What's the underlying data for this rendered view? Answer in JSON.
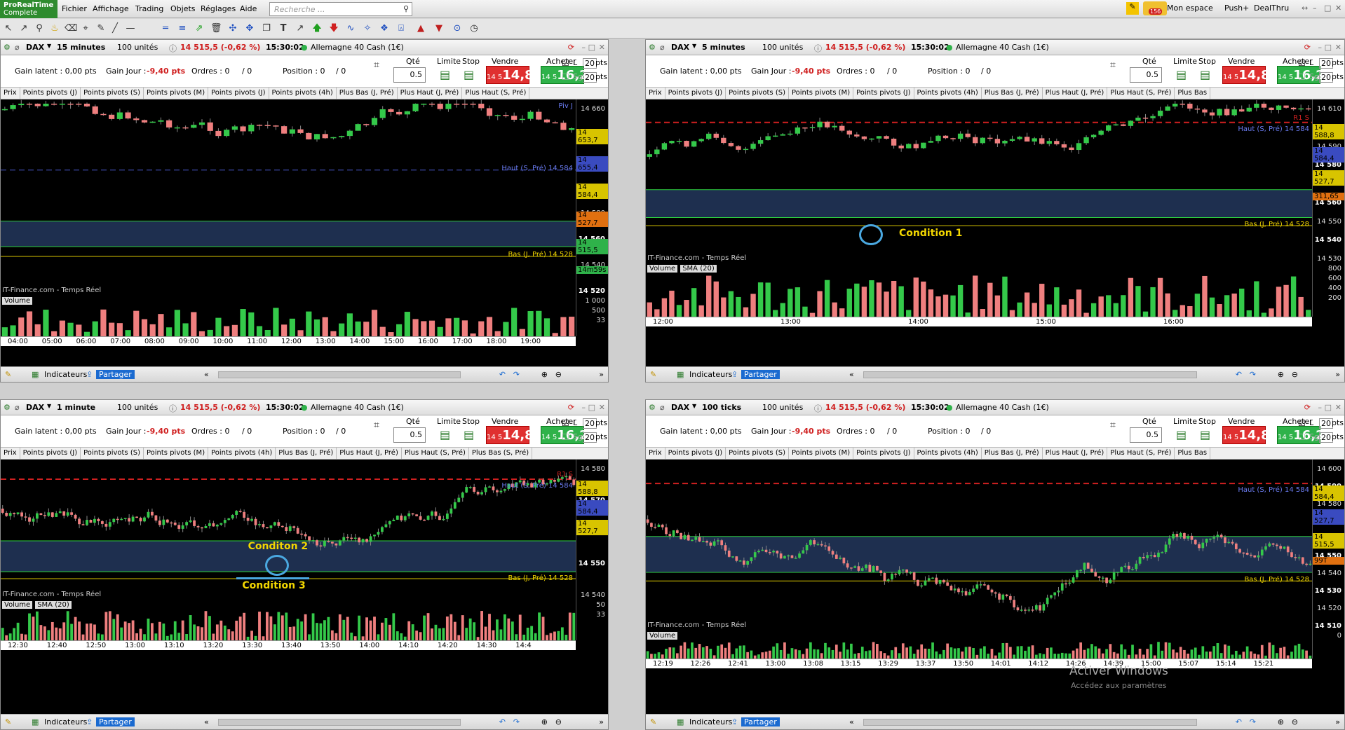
{
  "app": {
    "logo_line1": "ProRealTime",
    "logo_line2": "Complete"
  },
  "menu": [
    "Fichier",
    "Affichage",
    "Trading",
    "Objets",
    "Réglages",
    "Aide"
  ],
  "search": {
    "placeholder": "Recherche ..."
  },
  "topright": {
    "mon_espace": "Mon espace",
    "push": "Push+",
    "dealthru": "DealThru",
    "badge": "156"
  },
  "panels": [
    {
      "instrument": "DAX",
      "interval": "15 minutes",
      "units": "100 unités",
      "price_change": "14 515,5 (-0,62 %)",
      "time": "15:30:02",
      "market": "Allemagne 40 Cash (1€)",
      "gain_latent": "Gain latent : 0,00 pts",
      "gain_jour_label": "Gain Jour :",
      "gain_jour": "-9,40 pts",
      "ordres": "Ordres : 0",
      "ordres2": "/ 0",
      "position": "Position : 0",
      "position2": "/ 0",
      "qte_label": "Qté",
      "qte": "0.5",
      "limite": "Limite",
      "stop": "Stop",
      "vendre": "Vendre",
      "acheter": "Acheter",
      "sell_small": "14 5",
      "sell_big": "14,8",
      "buy_small": "14 5",
      "buy_big": "16,2",
      "l": "L",
      "sg": "Sg",
      "pts1": "20",
      "pts2": "20",
      "ptsl": "pts",
      "indicators": [
        "Prix",
        "Points pivots (J)",
        "Points pivots (S)",
        "Points pivots (M)",
        "Points pivots (J)",
        "Points pivots (4h)",
        "Plus Bas (J, Pré)",
        "Plus Haut (J, Pré)",
        "Plus Haut (S, Pré)"
      ],
      "yticks": [
        "14 660",
        "14 640",
        "14 620",
        "14 600",
        "14 580",
        "14 560",
        "14 540",
        "14 520"
      ],
      "price_tags": [
        "14 653,7",
        "14 655,4",
        "14 584,4",
        "14 527,7",
        "14 515,5",
        "14m59s"
      ],
      "labels": [
        "Piv J",
        "Haut (S, Pré) 14 584",
        "Bas (J, Pré) 14 528"
      ],
      "source": "IT-Finance.com - Temps Réel",
      "volume": "Volume",
      "vol_ticks": [
        "1 000",
        "500",
        "33"
      ],
      "xticks": [
        "04:00",
        "05:00",
        "06:00",
        "07:00",
        "08:00",
        "09:00",
        "10:00",
        "11:00",
        "12:00",
        "13:00",
        "14:00",
        "15:00",
        "16:00",
        "17:00",
        "18:00",
        "19:00"
      ],
      "footer": {
        "indicateurs": "Indicateurs",
        "partager": "Partager"
      }
    },
    {
      "instrument": "DAX",
      "interval": "5 minutes",
      "units": "100 unités",
      "price_change": "14 515,5 (-0,62 %)",
      "time": "15:30:02",
      "market": "Allemagne 40 Cash (1€)",
      "gain_latent": "Gain latent : 0,00 pts",
      "gain_jour_label": "Gain Jour :",
      "gain_jour": "-9,40 pts",
      "ordres": "Ordres : 0",
      "ordres2": "/ 0",
      "position": "Position : 0",
      "position2": "/ 0",
      "qte_label": "Qté",
      "qte": "0.5",
      "limite": "Limite",
      "stop": "Stop",
      "vendre": "Vendre",
      "acheter": "Acheter",
      "sell_small": "14 5",
      "sell_big": "14,8",
      "buy_small": "14 5",
      "buy_big": "16,2",
      "l": "L",
      "sg": "Sg",
      "pts1": "20",
      "pts2": "20",
      "ptsl": "pts",
      "indicators": [
        "Prix",
        "Points pivots (J)",
        "Points pivots (S)",
        "Points pivots (M)",
        "Points pivots (J)",
        "Points pivots (4h)",
        "Plus Bas (J, Pré)",
        "Plus Haut (J, Pré)",
        "Plus Haut (S, Pré)",
        "Plus Bas"
      ],
      "yticks": [
        "14 610",
        "14 600",
        "14 590",
        "14 580",
        "14 570",
        "14 560",
        "14 550",
        "14 540",
        "14 530"
      ],
      "price_tags": [
        "14 588,8",
        "14 584,4",
        "14 527,7",
        "311,65"
      ],
      "labels": [
        "R1 S",
        "Haut (S, Pré) 14 584",
        "Bas (J, Pré) 14 528"
      ],
      "annotation": "Condition 1",
      "source": "IT-Finance.com - Temps Réel",
      "volume": "Volume",
      "sma": "SMA (20)",
      "vol_ticks": [
        "800",
        "600",
        "400",
        "200"
      ],
      "xticks": [
        "12:00",
        "13:00",
        "14:00",
        "15:00",
        "16:00"
      ],
      "footer": {
        "indicateurs": "Indicateurs",
        "partager": "Partager"
      }
    },
    {
      "instrument": "DAX",
      "interval": "1 minute",
      "units": "100 unités",
      "price_change": "14 515,5 (-0,62 %)",
      "time": "15:30:02",
      "market": "Allemagne 40 Cash (1€)",
      "gain_latent": "Gain latent : 0,00 pts",
      "gain_jour_label": "Gain Jour :",
      "gain_jour": "-9,40 pts",
      "ordres": "Ordres : 0",
      "ordres2": "/ 0",
      "position": "Position : 0",
      "position2": "/ 0",
      "qte_label": "Qté",
      "qte": "0.5",
      "limite": "Limite",
      "stop": "Stop",
      "vendre": "Vendre",
      "acheter": "Acheter",
      "sell_small": "14 5",
      "sell_big": "14,8",
      "buy_small": "14 5",
      "buy_big": "16,2",
      "l": "L",
      "sg": "Sg",
      "pts1": "20",
      "pts2": "20",
      "ptsl": "pts",
      "indicators": [
        "Prix",
        "Points pivots (J)",
        "Points pivots (S)",
        "Points pivots (M)",
        "Points pivots (4h)",
        "Plus Bas (J, Pré)",
        "Plus Haut (J, Pré)",
        "Plus Haut (S, Pré)",
        "Plus Bas (S, Pré)"
      ],
      "yticks": [
        "14 580",
        "14 570",
        "14 560",
        "14 550",
        "14 540"
      ],
      "price_tags": [
        "14 588,8",
        "14 584,4",
        "14 527,7"
      ],
      "labels": [
        "R1 S",
        "Haut (S, Pré) 14 584",
        "Bas (J, Pré) 14 528"
      ],
      "annotation": "Conditon 2",
      "annotation2": "Condition 3",
      "source": "IT-Finance.com - Temps Réel",
      "volume": "Volume",
      "sma": "SMA (20)",
      "vol_ticks": [
        "50",
        "33"
      ],
      "xticks": [
        "12:30",
        "12:40",
        "12:50",
        "13:00",
        "13:10",
        "13:20",
        "13:30",
        "13:40",
        "13:50",
        "14:00",
        "14:10",
        "14:20",
        "14:30",
        "14:4"
      ],
      "footer": {
        "indicateurs": "Indicateurs",
        "partager": "Partager"
      }
    },
    {
      "instrument": "DAX",
      "interval": "100 ticks",
      "units": "100 unités",
      "price_change": "14 515,5 (-0,62 %)",
      "time": "15:30:02",
      "market": "Allemagne 40 Cash (1€)",
      "gain_latent": "Gain latent : 0,00 pts",
      "gain_jour_label": "Gain Jour :",
      "gain_jour": "-9,40 pts",
      "ordres": "Ordres : 0",
      "ordres2": "/ 0",
      "position": "Position : 0",
      "position2": "/ 0",
      "qte_label": "Qté",
      "qte": "0.5",
      "limite": "Limite",
      "stop": "Stop",
      "vendre": "Vendre",
      "acheter": "Acheter",
      "sell_small": "14 5",
      "sell_big": "14,8",
      "buy_small": "14 5",
      "buy_big": "16,2",
      "l": "L",
      "sg": "Sg",
      "pts1": "20",
      "pts2": "20",
      "ptsl": "pts",
      "indicators": [
        "Prix",
        "Points pivots (J)",
        "Points pivots (S)",
        "Points pivots (M)",
        "Points pivots (J)",
        "Points pivots (4h)",
        "Plus Bas (J, Pré)",
        "Plus Haut (J, Pré)",
        "Plus Haut (S, Pré)",
        "Plus Bas"
      ],
      "yticks": [
        "14 600",
        "14 590",
        "14 580",
        "14 570",
        "14 560",
        "14 550",
        "14 540",
        "14 530",
        "14 520",
        "14 510"
      ],
      "price_tags": [
        "14 584,4",
        "14 527,7",
        "14 515,5",
        "99T"
      ],
      "labels": [
        "Haut (S, Pré) 14 584",
        "Bas (J, Pré) 14 528"
      ],
      "source": "IT-Finance.com - Temps Réel",
      "volume": "Volume",
      "vol_ticks": [
        "0"
      ],
      "xticks": [
        "12:19",
        "12:26",
        "12:41",
        "13:00",
        "13:08",
        "13:15",
        "13:29",
        "13:37",
        "13:50",
        "14:01",
        "14:12",
        "14:26",
        "14:39",
        "15:00",
        "15:07",
        "15:14",
        "15:21"
      ],
      "footer": {
        "indicateurs": "Indicateurs",
        "partager": "Partager"
      }
    }
  ],
  "watermark": {
    "line1": "Activer Windows",
    "line2": "Accédez aux paramètres"
  },
  "colors": {
    "up": "#34c94a",
    "down": "#ef7f7f",
    "zone": "#1e2f4f",
    "accent": "#f2d600"
  }
}
